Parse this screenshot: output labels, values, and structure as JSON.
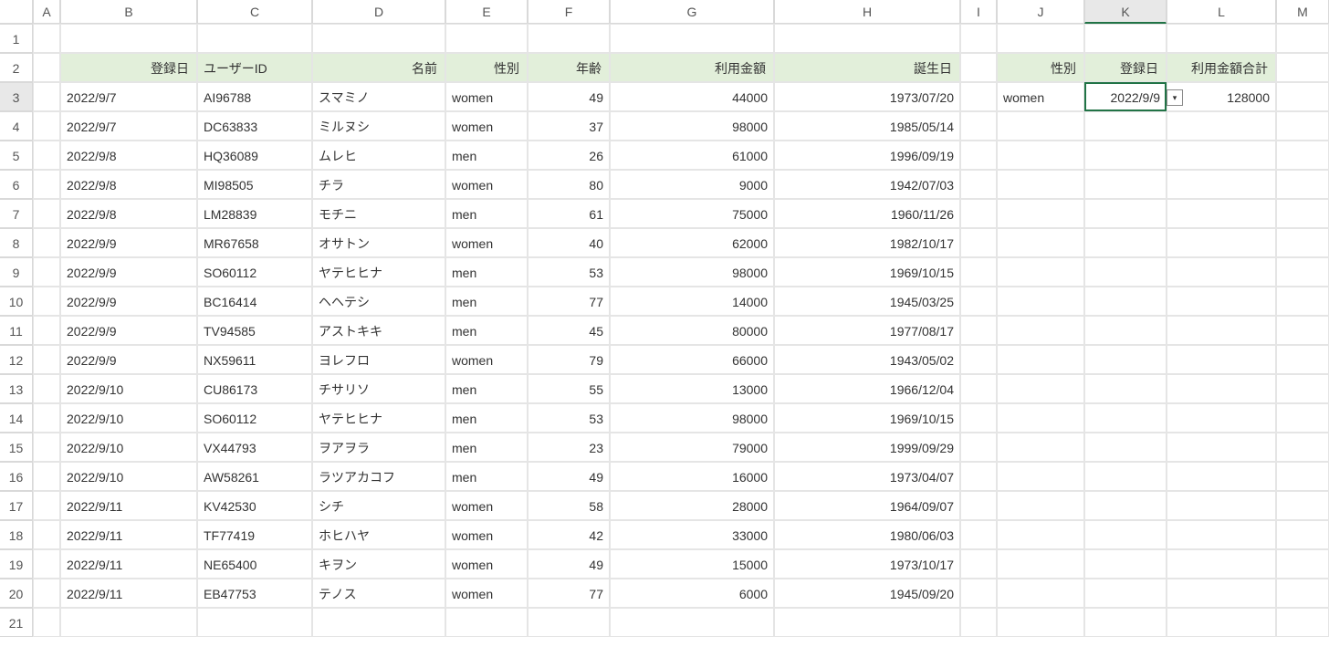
{
  "columns": [
    "",
    "A",
    "B",
    "C",
    "D",
    "E",
    "F",
    "G",
    "H",
    "I",
    "J",
    "K",
    "L",
    "M"
  ],
  "rowNumbers": [
    "1",
    "2",
    "3",
    "4",
    "5",
    "6",
    "7",
    "8",
    "9",
    "10",
    "11",
    "12",
    "13",
    "14",
    "15",
    "16",
    "17",
    "18",
    "19",
    "20",
    "21"
  ],
  "headers": {
    "B": "登録日",
    "C": "ユーザーID",
    "D": "名前",
    "E": "性別",
    "F": "年齢",
    "G": "利用金額",
    "H": "誕生日",
    "J": "性別",
    "K": "登録日",
    "L": "利用金額合計"
  },
  "data": [
    {
      "B": "2022/9/7",
      "C": "AI96788",
      "D": "スマミノ",
      "E": "women",
      "F": "49",
      "G": "44000",
      "H": "1973/07/20"
    },
    {
      "B": "2022/9/7",
      "C": "DC63833",
      "D": "ミルヌシ",
      "E": "women",
      "F": "37",
      "G": "98000",
      "H": "1985/05/14"
    },
    {
      "B": "2022/9/8",
      "C": "HQ36089",
      "D": "ムレヒ",
      "E": "men",
      "F": "26",
      "G": "61000",
      "H": "1996/09/19"
    },
    {
      "B": "2022/9/8",
      "C": "MI98505",
      "D": "チラ",
      "E": "women",
      "F": "80",
      "G": "9000",
      "H": "1942/07/03"
    },
    {
      "B": "2022/9/8",
      "C": "LM28839",
      "D": "モチニ",
      "E": "men",
      "F": "61",
      "G": "75000",
      "H": "1960/11/26"
    },
    {
      "B": "2022/9/9",
      "C": "MR67658",
      "D": "オサトン",
      "E": "women",
      "F": "40",
      "G": "62000",
      "H": "1982/10/17"
    },
    {
      "B": "2022/9/9",
      "C": "SO60112",
      "D": "ヤテヒヒナ",
      "E": "men",
      "F": "53",
      "G": "98000",
      "H": "1969/10/15"
    },
    {
      "B": "2022/9/9",
      "C": "BC16414",
      "D": "ヘヘテシ",
      "E": "men",
      "F": "77",
      "G": "14000",
      "H": "1945/03/25"
    },
    {
      "B": "2022/9/9",
      "C": "TV94585",
      "D": "アストキキ",
      "E": "men",
      "F": "45",
      "G": "80000",
      "H": "1977/08/17"
    },
    {
      "B": "2022/9/9",
      "C": "NX59611",
      "D": "ヨレフロ",
      "E": "women",
      "F": "79",
      "G": "66000",
      "H": "1943/05/02"
    },
    {
      "B": "2022/9/10",
      "C": "CU86173",
      "D": "チサリソ",
      "E": "men",
      "F": "55",
      "G": "13000",
      "H": "1966/12/04"
    },
    {
      "B": "2022/9/10",
      "C": "SO60112",
      "D": "ヤテヒヒナ",
      "E": "men",
      "F": "53",
      "G": "98000",
      "H": "1969/10/15"
    },
    {
      "B": "2022/9/10",
      "C": "VX44793",
      "D": "ヲアヲラ",
      "E": "men",
      "F": "23",
      "G": "79000",
      "H": "1999/09/29"
    },
    {
      "B": "2022/9/10",
      "C": "AW58261",
      "D": "ラツアカコフ",
      "E": "men",
      "F": "49",
      "G": "16000",
      "H": "1973/04/07"
    },
    {
      "B": "2022/9/11",
      "C": "KV42530",
      "D": "シチ",
      "E": "women",
      "F": "58",
      "G": "28000",
      "H": "1964/09/07"
    },
    {
      "B": "2022/9/11",
      "C": "TF77419",
      "D": "ホヒハヤ",
      "E": "women",
      "F": "42",
      "G": "33000",
      "H": "1980/06/03"
    },
    {
      "B": "2022/9/11",
      "C": "NE65400",
      "D": "キヲン",
      "E": "women",
      "F": "49",
      "G": "15000",
      "H": "1973/10/17"
    },
    {
      "B": "2022/9/11",
      "C": "EB47753",
      "D": "テノス",
      "E": "women",
      "F": "77",
      "G": "6000",
      "H": "1945/09/20"
    }
  ],
  "lookup": {
    "J3": "women",
    "K3": "2022/9/9",
    "L3": "128000"
  },
  "selectedCell": "K3",
  "activeCol": "K",
  "activeRow": 3
}
